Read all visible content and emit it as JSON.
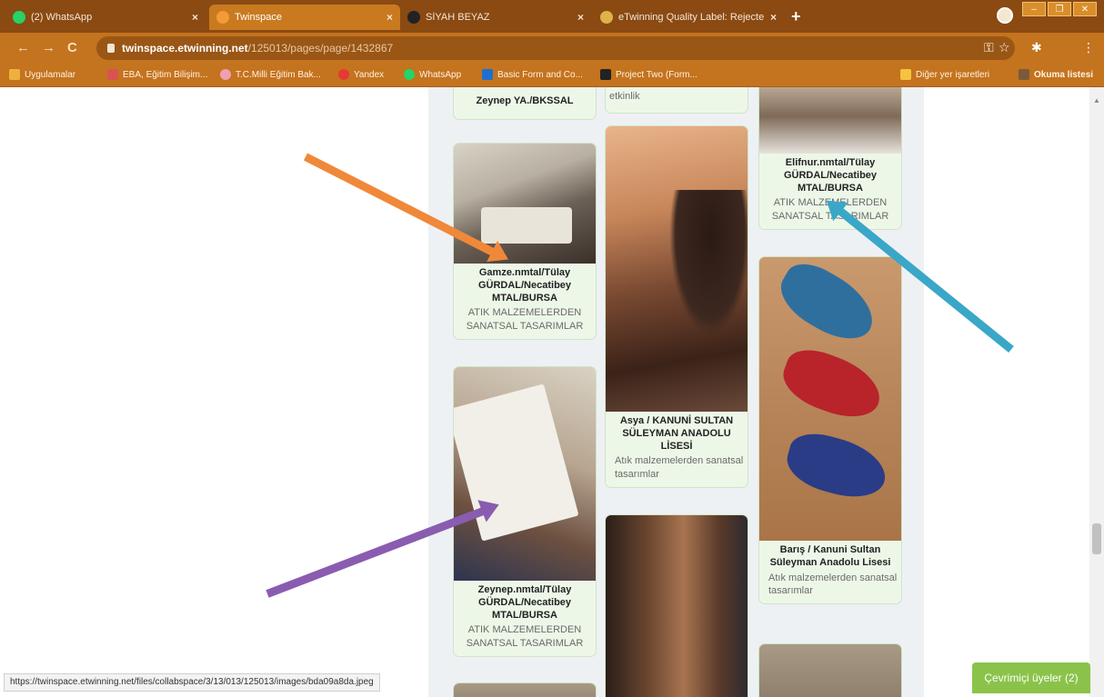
{
  "tabs": [
    {
      "title": "(2) WhatsApp",
      "close": "×",
      "favicon_color": "#25d366"
    },
    {
      "title": "Twinspace",
      "close": "×",
      "favicon_color": "#f29b38"
    },
    {
      "title": "SİYAH BEYAZ",
      "close": "×",
      "favicon_color": "#222222"
    },
    {
      "title": "eTwinning Quality Label: Rejecte",
      "close": "×",
      "favicon_color": "#e0b24a"
    }
  ],
  "new_tab": "+",
  "window_controls": [
    "–",
    "❐",
    "✕"
  ],
  "nav": {
    "back": "←",
    "forward": "→",
    "reload": "C"
  },
  "address": {
    "host": "twinspace.etwinning.net",
    "path": "/125013/pages/page/1432867"
  },
  "toolbar_icons": [
    "⚿",
    "☆",
    "✱",
    "⋮"
  ],
  "bookmarks": [
    {
      "label": "Uygulamalar",
      "color": "#f0b040"
    },
    {
      "label": "EBA, Eğitim Bilişim...",
      "color": "#d9534f"
    },
    {
      "label": "T.C.Milli Eğitim Bak...",
      "color": "#f0a0b0"
    },
    {
      "label": "Yandex",
      "color": "#e53935"
    },
    {
      "label": "WhatsApp",
      "color": "#25d366"
    },
    {
      "label": "Basic Form and Co...",
      "color": "#1e6fd0"
    },
    {
      "label": "Project Two (Form...",
      "color": "#222222"
    }
  ],
  "bookmarks_right": [
    {
      "label": "Diğer yer işaretleri",
      "color": "#f5c242"
    },
    {
      "label": "Okuma listesi",
      "color": "#7a5a3a"
    }
  ],
  "cards": {
    "top_left": {
      "author": "Zeynep YA./BKSSAL"
    },
    "top_mid": {
      "desc": "etkinlik"
    },
    "top_right": {
      "author": "Elifnur.nmtal/Tülay GÜRDAL/Necatibey MTAL/BURSA",
      "desc": "ATIK MALZEMELERDEN SANATSAL TASARIMLAR"
    },
    "gamze": {
      "author": "Gamze.nmtal/Tülay GÜRDAL/Necatibey MTAL/BURSA",
      "desc": "ATIK MALZEMELERDEN SANATSAL TASARIMLAR"
    },
    "asya": {
      "author": "Asya / KANUNİ SULTAN SÜLEYMAN ANADOLU LİSESİ",
      "desc": "Atık malzemelerden sanatsal tasarımlar"
    },
    "baris": {
      "author": "Barış / Kanuni Sultan Süleyman Anadolu Lisesi",
      "desc": "Atık malzemelerden sanatsal tasarımlar"
    },
    "zeynep": {
      "author": "Zeynep.nmtal/Tülay GÜRDAL/Necatibey MTAL/BURSA",
      "desc": "ATIK MALZEMELERDEN SANATSAL TASARIMLAR"
    }
  },
  "arrows": {
    "orange": "#f0883a",
    "blue": "#3aa7c8",
    "purple": "#8a5cb0"
  },
  "status_url": "https://twinspace.etwinning.net/files/collabspace/3/13/013/125013/images/bda09a8da.jpeg",
  "online_users": "Çevrimiçi üyeler (2)"
}
